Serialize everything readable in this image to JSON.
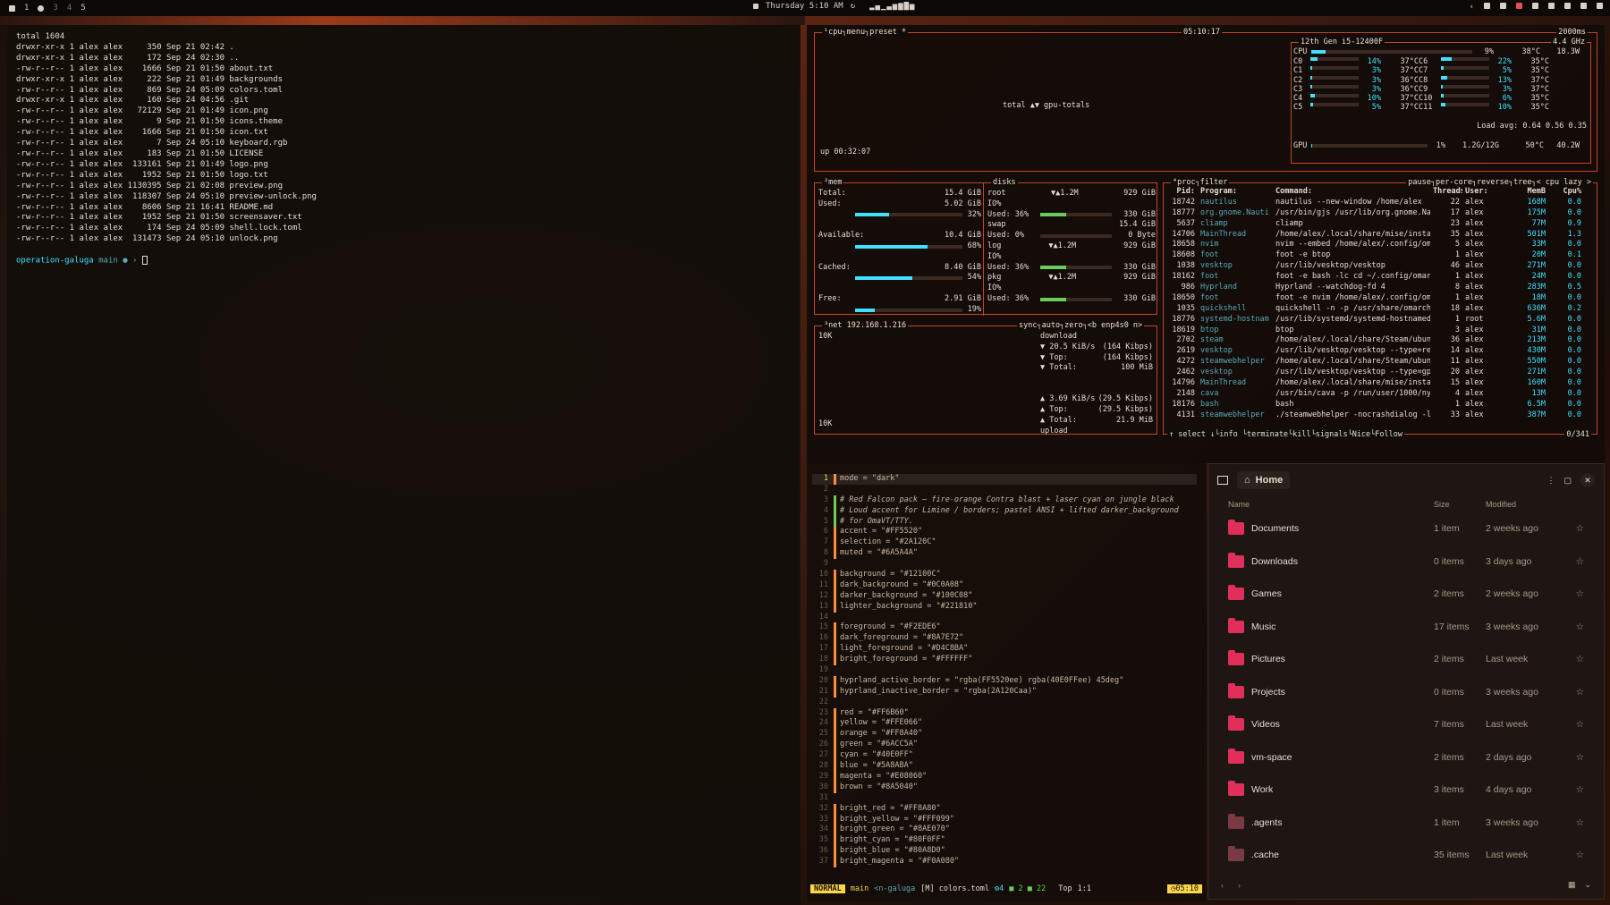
{
  "topbar": {
    "workspaces": [
      "1",
      "3",
      "4",
      "5"
    ],
    "clock": "Thursday 5:10 AM",
    "visualizer": "▂▄▁▃▅▆▇▅"
  },
  "terminal": {
    "total": "total 1604",
    "rows": [
      "drwxr-xr-x 1 alex alex     350 Sep 21 02:42 .",
      "drwxr-xr-x 1 alex alex     172 Sep 24 02:30 ..",
      "-rw-r--r-- 1 alex alex    1666 Sep 21 01:50 about.txt",
      "drwxr-xr-x 1 alex alex     222 Sep 21 01:49 backgrounds",
      "-rw-r--r-- 1 alex alex     869 Sep 24 05:09 colors.toml",
      "drwxr-xr-x 1 alex alex     160 Sep 24 04:56 .git",
      "-rw-r--r-- 1 alex alex   72129 Sep 21 01:49 icon.png",
      "-rw-r--r-- 1 alex alex       9 Sep 21 01:50 icons.theme",
      "-rw-r--r-- 1 alex alex    1666 Sep 21 01:50 icon.txt",
      "-rw-r--r-- 1 alex alex       7 Sep 24 05:10 keyboard.rgb",
      "-rw-r--r-- 1 alex alex     183 Sep 21 01:50 LICENSE",
      "-rw-r--r-- 1 alex alex  133161 Sep 21 01:49 logo.png",
      "-rw-r--r-- 1 alex alex    1952 Sep 21 01:50 logo.txt",
      "-rw-r--r-- 1 alex alex 1130395 Sep 21 02:08 preview.png",
      "-rw-r--r-- 1 alex alex  118307 Sep 24 05:10 preview-unlock.png",
      "-rw-r--r-- 1 alex alex    8606 Sep 21 16:41 README.md",
      "-rw-r--r-- 1 alex alex    1952 Sep 21 01:50 screensaver.txt",
      "-rw-r--r-- 1 alex alex     174 Sep 24 05:09 shell.lock.toml",
      "-rw-r--r-- 1 alex alex  131473 Sep 24 05:10 unlock.png"
    ],
    "prompt_dir": "operation-galuga",
    "prompt_branch": "main ● ›"
  },
  "btop": {
    "cpu_title": "¹cpu┐menu┐preset *",
    "time": "05:10:17",
    "interval": "2000ms",
    "graph_label": "total ▲▼ gpu-totals",
    "uptime": "up 00:32:07",
    "cpu_name": "12th Gen i5-12400F",
    "freq": "4.4 GHz",
    "cpu_total_pct": "9%",
    "cpu_temp": "38°C",
    "cpu_watt": "18.3W",
    "cores": [
      [
        "C0",
        "14%",
        "37°C",
        "C6",
        "22%",
        "35°C"
      ],
      [
        "C1",
        "3%",
        "37°C",
        "C7",
        "5%",
        "35°C"
      ],
      [
        "C2",
        "3%",
        "36°C",
        "C8",
        "13%",
        "37°C"
      ],
      [
        "C3",
        "3%",
        "36°C",
        "C9",
        "3%",
        "37°C"
      ],
      [
        "C4",
        "10%",
        "37°C",
        "C10",
        "6%",
        "35°C"
      ],
      [
        "C5",
        "5%",
        "37°C",
        "C11",
        "10%",
        "35°C"
      ]
    ],
    "load_avg": "Load avg: 0.64 0.56 0.35",
    "gpu": {
      "label": "GPU",
      "pct": "1%",
      "mem": "1.2G/12G",
      "temp": "50°C",
      "watt": "40.2W"
    },
    "mem": {
      "title": "²mem",
      "total": [
        "Total:",
        "15.4 GiB"
      ],
      "used": [
        "Used:",
        "5.02 GiB",
        "32%"
      ],
      "available": [
        "Available:",
        "10.4 GiB",
        "68%"
      ],
      "cached": [
        "Cached:",
        "8.40 GiB",
        "54%"
      ],
      "free": [
        "Free:",
        "2.91 GiB",
        "19%"
      ]
    },
    "disks": {
      "title": "disks",
      "items": [
        {
          "name": "root",
          "io": "▼▲1.2M",
          "size": "929 GiB",
          "iolbl": "IO%",
          "used": "Used: 36%",
          "usedsize": "330 GiB"
        },
        {
          "name": "swap",
          "io": "",
          "size": "15.4 GiB",
          "iolbl": "",
          "used": "Used: 0%",
          "usedsize": "0 Byte"
        },
        {
          "name": "log",
          "io": "▼▲1.2M",
          "size": "929 GiB",
          "iolbl": "IO%",
          "used": "Used: 36%",
          "usedsize": "330 GiB"
        },
        {
          "name": "pkg",
          "io": "▼▲1.2M",
          "size": "929 GiB",
          "iolbl": "IO%",
          "used": "Used: 36%",
          "usedsize": "330 GiB"
        }
      ]
    },
    "net": {
      "title": "³net",
      "ip": "192.168.1.216",
      "opts": "sync┐auto┐zero┐<b enp4s0 n>",
      "scale_top": "10K",
      "scale_bottom": "10K",
      "download": "download",
      "dl_rate": [
        "▼ 20.5 KiB/s",
        "(164 Kibps)"
      ],
      "dl_top": [
        "▼ Top:",
        "(164 Kibps)"
      ],
      "dl_total": [
        "▼ Total:",
        "100 MiB"
      ],
      "ul_rate": [
        "▲ 3.69 KiB/s",
        "(29.5 Kibps)"
      ],
      "ul_top": [
        "▲ Top:",
        "(29.5 Kibps)"
      ],
      "ul_total": [
        "▲ Total:",
        "21.9 MiB"
      ],
      "upload": "upload"
    },
    "proc": {
      "title": "⁴proc┐filter",
      "opts": "pause┐per-core┐reverse┐tree┐< cpu lazy >",
      "headers": [
        "Pid:",
        "Program:",
        "Command:",
        "Threads:",
        "User:",
        "MemB",
        "Cpu%"
      ],
      "rows": [
        [
          "18742",
          "nautilus",
          "nautilus --new-window /home/alex",
          "22",
          "alex",
          "168M",
          "0.0"
        ],
        [
          "18777",
          "org.gnome.Nauti",
          "/usr/bin/gjs /usr/lib/org.gnome.Na",
          "17",
          "alex",
          "175M",
          "0.0"
        ],
        [
          "5637",
          "cliamp",
          "cliamp",
          "23",
          "alex",
          "77M",
          "0.9"
        ],
        [
          "14706",
          "MainThread",
          "/home/alex/.local/share/mise/insta",
          "35",
          "alex",
          "501M",
          "1.3"
        ],
        [
          "18658",
          "nvim",
          "nvim --embed /home/alex/.config/om",
          "5",
          "alex",
          "33M",
          "0.0"
        ],
        [
          "18608",
          "foot",
          "foot -e btop",
          "1",
          "alex",
          "20M",
          "0.1"
        ],
        [
          "1038",
          "vesktop",
          "/usr/lib/vesktop/vesktop",
          "46",
          "alex",
          "271M",
          "0.0"
        ],
        [
          "18162",
          "foot",
          "foot -e bash -lc cd ~/.config/omar",
          "1",
          "alex",
          "24M",
          "0.0"
        ],
        [
          "986",
          "Hyprland",
          "Hyprland --watchdog-fd 4",
          "8",
          "alex",
          "283M",
          "0.5"
        ],
        [
          "18650",
          "foot",
          "foot -e nvim /home/alex/.config/om",
          "1",
          "alex",
          "18M",
          "0.0"
        ],
        [
          "1035",
          "quickshell",
          "quickshell -n -p /usr/share/omarch",
          "18",
          "alex",
          "636M",
          "0.2"
        ],
        [
          "18776",
          "systemd-hostnam",
          "/usr/lib/systemd/systemd-hostnamed",
          "1",
          "root",
          "5.6M",
          "0.0"
        ],
        [
          "18619",
          "btop",
          "btop",
          "3",
          "alex",
          "31M",
          "0.0"
        ],
        [
          "2702",
          "steam",
          "/home/alex/.local/share/Steam/ubun",
          "36",
          "alex",
          "213M",
          "0.0"
        ],
        [
          "2619",
          "vesktop",
          "/usr/lib/vesktop/vesktop --type=re",
          "14",
          "alex",
          "430M",
          "0.0"
        ],
        [
          "4272",
          "steamwebhelper",
          "/home/alex/.local/share/Steam/ubun",
          "11",
          "alex",
          "550M",
          "0.0"
        ],
        [
          "2462",
          "vesktop",
          "/usr/lib/vesktop/vesktop --type=gp",
          "20",
          "alex",
          "271M",
          "0.0"
        ],
        [
          "14796",
          "MainThread",
          "/home/alex/.local/share/mise/insta",
          "15",
          "alex",
          "160M",
          "0.0"
        ],
        [
          "2148",
          "cava",
          "/usr/bin/cava -p /run/user/1000/ny",
          "4",
          "alex",
          "13M",
          "0.0"
        ],
        [
          "18176",
          "bash",
          "bash",
          "1",
          "alex",
          "6.5M",
          "0.0"
        ],
        [
          "4131",
          "steamwebhelper",
          "./steamwebhelper -nocrashdialog -l",
          "33",
          "alex",
          "387M",
          "0.0"
        ]
      ],
      "footer": "↑ select ↓└info └terminate└kill└signals└Nice└Follow",
      "count": "0/341"
    }
  },
  "editor": {
    "lines": [
      [
        "1",
        "mode = \"dark\""
      ],
      [
        "2",
        ""
      ],
      [
        "3",
        "# Red Falcon pack — fire-orange Contra blast + laser cyan on jungle black"
      ],
      [
        "4",
        "# Loud accent for Limine / borders; pastel ANSI + lifted darker_background"
      ],
      [
        "5",
        "# for OmaVT/TTY."
      ],
      [
        "6",
        "accent = \"#FF5520\""
      ],
      [
        "7",
        "selection = \"#2A120C\""
      ],
      [
        "8",
        "muted = \"#6A5A4A\""
      ],
      [
        "9",
        ""
      ],
      [
        "10",
        "background = \"#12100C\""
      ],
      [
        "11",
        "dark_background = \"#0C0A08\""
      ],
      [
        "12",
        "darker_background = \"#100C08\""
      ],
      [
        "13",
        "lighter_background = \"#221810\""
      ],
      [
        "14",
        ""
      ],
      [
        "15",
        "foreground = \"#F2EDE6\""
      ],
      [
        "16",
        "dark_foreground = \"#8A7E72\""
      ],
      [
        "17",
        "light_foreground = \"#D4C8BA\""
      ],
      [
        "18",
        "bright_foreground = \"#FFFFFF\""
      ],
      [
        "19",
        ""
      ],
      [
        "20",
        "hyprland_active_border = \"rgba(FF5520ee) rgba(40E0FFee) 45deg\""
      ],
      [
        "21",
        "hyprland_inactive_border = \"rgba(2A120Caa)\""
      ],
      [
        "22",
        ""
      ],
      [
        "23",
        "red = \"#FF6B60\""
      ],
      [
        "24",
        "yellow = \"#FFE066\""
      ],
      [
        "25",
        "orange = \"#FF8A40\""
      ],
      [
        "26",
        "green = \"#6ACC5A\""
      ],
      [
        "27",
        "cyan = \"#40E0FF\""
      ],
      [
        "28",
        "blue = \"#5A8ABA\""
      ],
      [
        "29",
        "magenta = \"#E08060\""
      ],
      [
        "30",
        "brown = \"#8A5040\""
      ],
      [
        "31",
        ""
      ],
      [
        "32",
        "bright_red = \"#FF8A80\""
      ],
      [
        "33",
        "bright_yellow = \"#FFF099\""
      ],
      [
        "34",
        "bright_green = \"#8AE070\""
      ],
      [
        "35",
        "bright_cyan = \"#80F0FF\""
      ],
      [
        "36",
        "bright_blue = \"#80A8D0\""
      ],
      [
        "37",
        "bright_magenta = \"#F0A080\""
      ]
    ],
    "status": {
      "mode": "NORMAL",
      "branch": " main",
      "dir": "<n-galuga",
      "file": "[M] colors.toml",
      "lsp": "⚙4",
      "diag": "■ 2 ■ 22",
      "pos": "Top",
      "lc": "1:1",
      "clock": "◷05:10"
    }
  },
  "files": {
    "location": "Home",
    "col_name": "Name",
    "col_size": "Size",
    "col_modified": "Modified",
    "rows": [
      {
        "name": "Documents",
        "size": "1 item",
        "mod": "2 weeks ago"
      },
      {
        "name": "Downloads",
        "size": "0 items",
        "mod": "3 days ago"
      },
      {
        "name": "Games",
        "size": "2 items",
        "mod": "2 weeks ago"
      },
      {
        "name": "Music",
        "size": "17 items",
        "mod": "3 weeks ago"
      },
      {
        "name": "Pictures",
        "size": "2 items",
        "mod": "Last week"
      },
      {
        "name": "Projects",
        "size": "0 items",
        "mod": "3 weeks ago"
      },
      {
        "name": "Videos",
        "size": "7 items",
        "mod": "Last week"
      },
      {
        "name": "vm-space",
        "size": "2 items",
        "mod": "2 days ago"
      },
      {
        "name": "Work",
        "size": "3 items",
        "mod": "4 days ago"
      },
      {
        "name": ".agents",
        "size": "1 item",
        "mod": "3 weeks ago"
      },
      {
        "name": ".cache",
        "size": "35 items",
        "mod": "Last week"
      }
    ]
  }
}
